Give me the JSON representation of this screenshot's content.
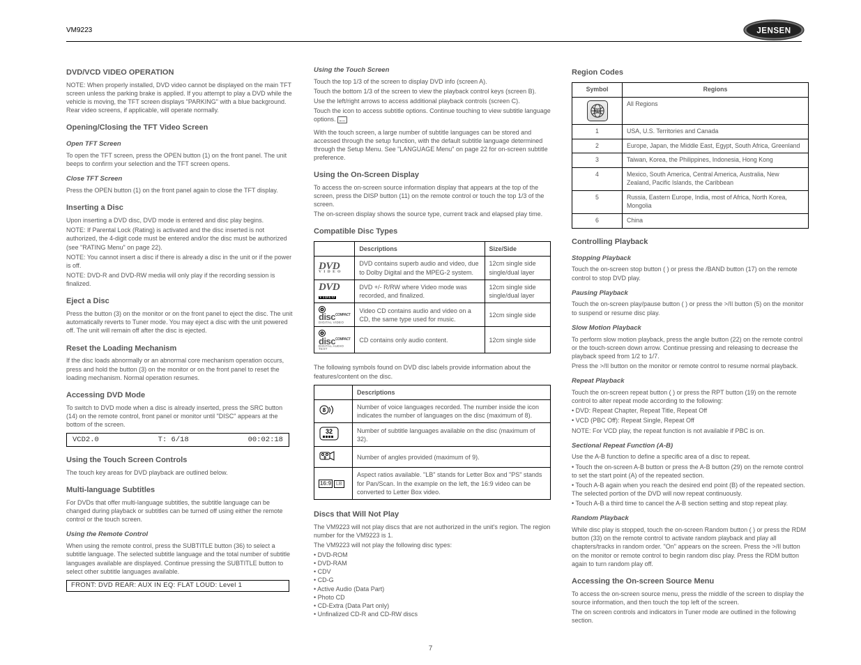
{
  "header": {
    "title": "VM9223"
  },
  "pagenum": "7",
  "col1": {
    "heading": "DVD/VCD VIDEO OPERATION",
    "note": "NOTE: When properly installed, DVD video cannot be displayed on the main TFT screen unless the parking brake is applied. If you attempt to play a DVD while the vehicle is moving, the TFT screen displays \"PARKING\" with a blue background. Rear video screens, if applicable, will operate normally.",
    "openclose_h": "Opening/Closing the TFT Video Screen",
    "open_h": "Open TFT Screen",
    "open_p": "To open the TFT screen, press the OPEN button (1) on the front panel. The unit beeps to confirm your selection and the TFT screen opens.",
    "close_h": "Close TFT Screen",
    "close_p": "Press the OPEN button (1) on the front panel again to close the TFT display.",
    "insert_h": "Inserting a Disc",
    "insert_p": "Upon inserting a DVD disc, DVD mode is entered and disc play begins.",
    "insert_n1": "NOTE: If Parental Lock (Rating) is activated and the disc inserted is not authorized, the 4-digit code must be entered and/or the disc must be authorized (see \"RATING Menu\" on page 22).",
    "insert_n2": "NOTE: You cannot insert a disc if there is already a disc in the unit or if the power is off.",
    "insert_n3": "NOTE: DVD-R and DVD-RW media will only play if the recording session is finalized.",
    "eject_h": "Eject a Disc",
    "eject_p": "Press the     button (3) on the monitor or on the front panel to eject the disc. The unit automatically reverts to Tuner mode. You may eject a disc with the unit powered off. The unit will remain off after the disc is ejected.",
    "reset_h": "Reset the Loading Mechanism",
    "reset_p": "If the disc loads abnormally or an abnormal core mechanism operation occurs, press and hold the     button (3) on the monitor or on the front panel to reset the loading mechanism. Normal operation resumes.",
    "acc_h": "Accessing DVD Mode",
    "acc_p": "To switch to DVD mode when a disc is already inserted, press the SRC button (14) on the remote control, front panel or monitor until \"DISC\" appears at the bottom of the screen.",
    "ctrl_h": "Using the Touch Screen Controls",
    "ctrl_p": "The touch key areas for DVD playback are outlined below.",
    "sub_h": "Multi-language Subtitles",
    "sub_p": "For DVDs that offer multi-language subtitles, the subtitle language can be changed during playback or subtitles can be turned off using either the remote control or the touch screen.",
    "remote_h": "Using the Remote Control",
    "remote_p": "When using the remote control, press the SUBTITLE button (36) to select a subtitle language. The selected subtitle language and the total number of subtitle languages available are displayed. Continue pressing the SUBTITLE button to select other subtitle languages available.",
    "touch_h": "Using the Touch Screen",
    "touch_list": [
      "Touch the top 1/3 of the screen to display DVD info (screen A).",
      "Touch the bottom 1/3 of the screen to view the playback control keys (screen B).",
      "Use the left/right arrows to access additional playback controls (screen C).",
      "Touch the     icon to access subtitle options. Continue touching to view subtitle language options."
    ],
    "osd_h": "Using the On-Screen Display",
    "osd_p1": "To access the on-screen source information display that appears at the top of the screen, press the DISP button (11) on the remote control or touch the top 1/3 of the screen.",
    "osd_p2": "The on-screen display shows the source type, current track and elapsed play time.",
    "osd_box": {
      "a": "VCD2.0",
      "b": "T: 6/18",
      "c": "00:02:18"
    },
    "ctrlplay_h": "Controlling Playback",
    "stop_h": "Stopping Playback",
    "stop_p": "Touch the on-screen stop button (   ) or press the   /BAND button (17) on the remote control to stop DVD play.",
    "pause_h": "Pausing Playback",
    "pause_p": "Touch the on-screen play/pause button (   ) or press the >/II button (5) on the monitor to suspend or resume disc play.",
    "slow_h": "Slow Motion Playback",
    "slow_p1": "To perform slow motion playback, press the angle button    (22) on the remote control or the touch-screen down arrow. Continue pressing and releasing to decrease the playback speed from 1/2 to 1/7.",
    "slow_p2": "Press the >/II button on the monitor or remote control to resume normal playback.",
    "repeat_h": "Repeat Playback",
    "repeat_p1": "Touch the on-screen repeat button (   ) or press the RPT button (19) on the remote control to alter repeat mode according to the following:",
    "repeat_li1": "DVD: Repeat Chapter, Repeat Title, Repeat Off",
    "repeat_li2": "VCD (PBC Off): Repeat Single, Repeat Off",
    "repeat_n": "NOTE: For VCD play, the repeat function is not available if PBC is on.",
    "sect_h": "Sectional Repeat Function (A-B)",
    "sect_p": "Use the A-B function to define a specific area of a disc to repeat.",
    "sect_li1": "Touch the on-screen A-B button or press the A-B button (29) on the remote control to set the start point (A) of the repeated section.",
    "sect_li2": "Touch A-B again when you reach the desired end point (B) of the repeated section. The selected portion of the DVD will now repeat continuously.",
    "sect_li3": "Touch A-B a third time to cancel the A-B section setting and stop repeat play.",
    "rand_h": "Random Playback",
    "rand_p": "While disc play is stopped, touch the on-screen Random button (   ) or press the RDM button (33) on the remote control to activate random playback and play all chapters/tracks in random order. \"On\" appears on the screen. Press the >/II button on the monitor or remote control to begin random disc play. Press the RDM button again to turn random play off.",
    "src_h": "Accessing the On-screen Source Menu",
    "src_p1": "To access the on-screen source menu, press the middle of the screen to display the source information, and then touch the top left of the screen.",
    "src_box": "FRONT: DVD   REAR: AUX IN   EQ: FLAT   LOUD: Level 1",
    "src_p2": "The on screen controls and indicators in Tuner mode are outlined in the following section."
  },
  "col2": {
    "p1": "With the touch screen, a large number of subtitle languages can be stored and accessed through the setup function, with the default subtitle language determined through the Setup Menu. See \"LANGUAGE Menu\" on page 22 for on-screen subtitle preference.",
    "compat_h": "Compatible Disc Types",
    "table1_head": [
      "",
      "Descriptions",
      "Size/Side"
    ],
    "table1_rows": [
      [
        "dvd",
        "DVD contains superb audio and video, due to Dolby Digital and the MPEG-2 system.",
        "12cm single side single/dual layer"
      ],
      [
        "dvdr",
        "DVD +/- R/RW where Video mode was recorded, and finalized.",
        "12cm single side single/dual layer"
      ],
      [
        "vcd",
        "Video CD contains audio and video on a CD, the same type used for music.",
        "12cm single side"
      ],
      [
        "cd",
        "CD contains only audio content.",
        "12cm single side"
      ]
    ],
    "feat_p": "The following symbols found on DVD disc labels provide information about the features/content on the disc.",
    "table2_head": [
      "",
      "Descriptions"
    ],
    "table2_rows": [
      [
        "lang",
        "Number of voice languages recorded. The number inside the icon indicates the number of languages on the disc (maximum of 8)."
      ],
      [
        "sub",
        "Number of subtitle languages available on the disc (maximum of 32)."
      ],
      [
        "angle",
        "Number of angles provided (maximum of 9)."
      ],
      [
        "aspect",
        "Aspect ratios available. \"LB\" stands for Letter Box and \"PS\" stands for Pan/Scan. In the example on the left, the 16:9 video can be converted to Letter Box video."
      ]
    ],
    "wont_h": "Discs that Will Not Play",
    "wont_p1": "The VM9223 will not play discs that are not authorized in the unit's region. The region number for the VM9223 is 1.",
    "wont_p2": "The VM9223 will not play the following disc types:",
    "wont_list": [
      "DVD-ROM",
      "DVD-RAM",
      "CDV",
      "CD-G",
      "Active Audio (Data Part)",
      "Photo CD",
      "CD-Extra (Data Part only)",
      "Unfinalized CD-R and CD-RW discs"
    ]
  },
  "col3": {
    "region_h": "Region Codes",
    "table_head": [
      "Symbol",
      "Regions"
    ],
    "rows": [
      [
        "ALL",
        "All Regions"
      ],
      [
        "1",
        "USA, U.S. Territories and Canada"
      ],
      [
        "2",
        "Europe, Japan, the Middle East, Egypt, South Africa, Greenland"
      ],
      [
        "3",
        "Taiwan, Korea, the Philippines, Indonesia, Hong Kong"
      ],
      [
        "4",
        "Mexico, South America, Central America, Australia, New Zealand, Pacific Islands, the Caribbean"
      ],
      [
        "5",
        "Russia, Eastern Europe, India, most of Africa, North Korea, Mongolia"
      ],
      [
        "6",
        "China"
      ]
    ]
  }
}
